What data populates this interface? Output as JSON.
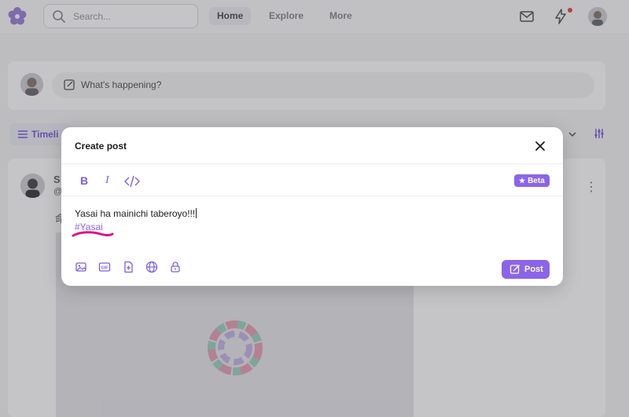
{
  "header": {
    "search_placeholder": "Search...",
    "nav": [
      {
        "label": "Home",
        "active": true
      },
      {
        "label": "Explore",
        "active": false
      },
      {
        "label": "More",
        "active": false
      }
    ],
    "icons": [
      "flower-logo-icon",
      "search-icon",
      "mail-icon",
      "lightning-icon",
      "avatar"
    ]
  },
  "composer": {
    "placeholder": "What's happening?"
  },
  "timeline": {
    "tab_label": "Timeli"
  },
  "feed": {
    "fragment_name": "S",
    "fragment_handle": "@",
    "fragment_text": "命"
  },
  "modal": {
    "title": "Create post",
    "format_bold": "B",
    "format_italic": "I",
    "beta_label": "Beta",
    "body_line1": "Yasai ha mainichi taberoyo!!!",
    "body_hashtag": "#Yasai",
    "post_label": "Post"
  },
  "colors": {
    "accent": "#8b65e8",
    "highlight_annotation": "#e0108c",
    "notification": "#e5484d"
  }
}
